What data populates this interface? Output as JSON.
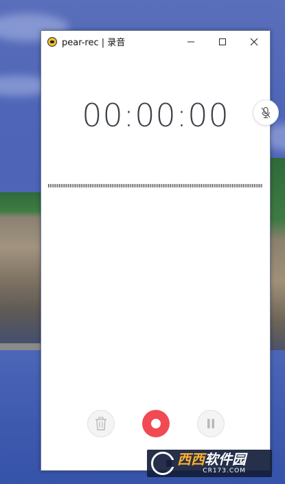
{
  "window": {
    "title": "pear-rec | 录音"
  },
  "recorder": {
    "timer": "00:00:00",
    "waveform_bars": 118
  },
  "controls": {
    "delete_icon": "trash-icon",
    "record_icon": "record-icon",
    "pause_icon": "pause-icon",
    "mic_icon": "mic-off-icon"
  },
  "colors": {
    "record": "#f14a52",
    "timer_text": "#3b4047"
  },
  "watermark": {
    "main_part1": "西西",
    "main_part2": "软件园",
    "sub": "CR173.COM"
  }
}
